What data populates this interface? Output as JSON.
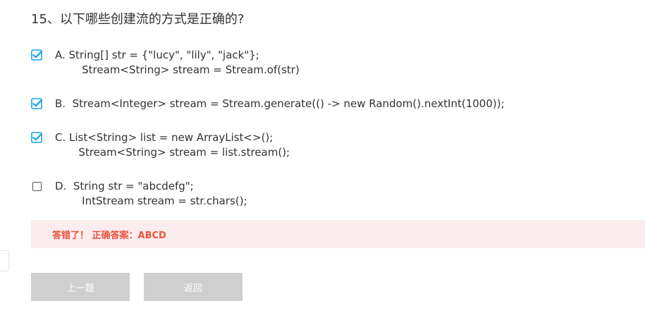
{
  "question": {
    "title": "15、以下哪些创建流的方式是正确的?"
  },
  "options": [
    {
      "checked": true,
      "line1": "A. String[] str = {\"lucy\", \"lily\", \"jack\"};",
      "line2": "        Stream<String> stream = Stream.of(str)"
    },
    {
      "checked": true,
      "line1": "B.  Stream<Integer> stream = Stream.generate(() -> new Random().nextInt(1000));",
      "line2": ""
    },
    {
      "checked": true,
      "line1": "C. List<String> list = new ArrayList<>();",
      "line2": "       Stream<String> stream = list.stream();"
    },
    {
      "checked": false,
      "line1": "D.  String str = \"abcdefg\";",
      "line2": "        IntStream stream = str.chars();"
    }
  ],
  "result": {
    "text": "答错了！ 正确答案：ABCD"
  },
  "buttons": {
    "prev_label": "上一题",
    "back_label": "返回"
  },
  "colors": {
    "checkbox_checked": "#1aa3e8",
    "result_bg": "#fdecee",
    "result_text": "#e8543f",
    "button_bg": "#cfcfcf"
  },
  "icons": {
    "checked": "check-square-icon",
    "unchecked": "empty-square-icon"
  }
}
